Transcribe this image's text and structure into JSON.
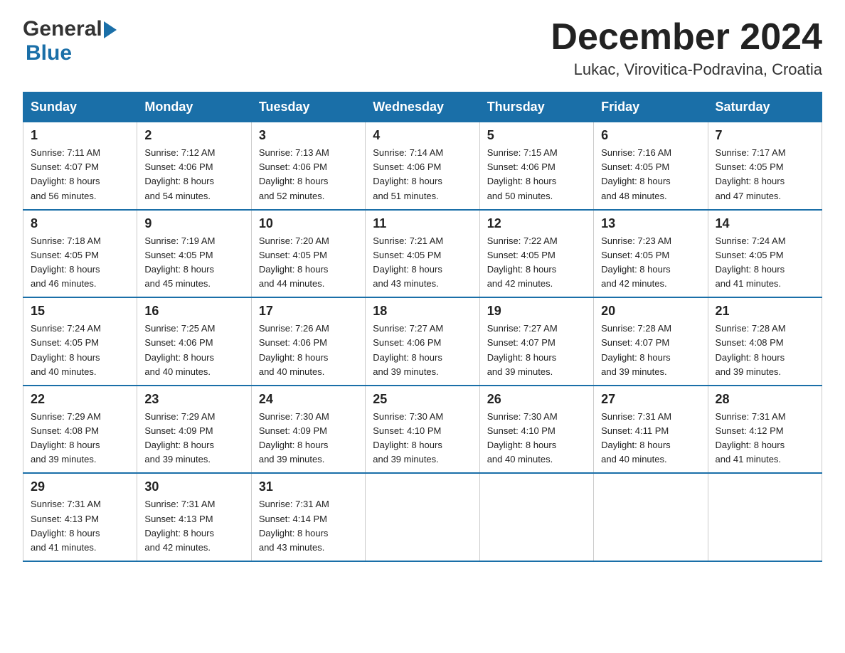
{
  "header": {
    "logo_general": "General",
    "logo_blue": "Blue",
    "title": "December 2024",
    "location": "Lukac, Virovitica-Podravina, Croatia"
  },
  "days_of_week": [
    "Sunday",
    "Monday",
    "Tuesday",
    "Wednesday",
    "Thursday",
    "Friday",
    "Saturday"
  ],
  "weeks": [
    [
      {
        "day": "1",
        "sunrise": "7:11 AM",
        "sunset": "4:07 PM",
        "daylight_hours": "8 hours",
        "daylight_minutes": "56 minutes"
      },
      {
        "day": "2",
        "sunrise": "7:12 AM",
        "sunset": "4:06 PM",
        "daylight_hours": "8 hours",
        "daylight_minutes": "54 minutes"
      },
      {
        "day": "3",
        "sunrise": "7:13 AM",
        "sunset": "4:06 PM",
        "daylight_hours": "8 hours",
        "daylight_minutes": "52 minutes"
      },
      {
        "day": "4",
        "sunrise": "7:14 AM",
        "sunset": "4:06 PM",
        "daylight_hours": "8 hours",
        "daylight_minutes": "51 minutes"
      },
      {
        "day": "5",
        "sunrise": "7:15 AM",
        "sunset": "4:06 PM",
        "daylight_hours": "8 hours",
        "daylight_minutes": "50 minutes"
      },
      {
        "day": "6",
        "sunrise": "7:16 AM",
        "sunset": "4:05 PM",
        "daylight_hours": "8 hours",
        "daylight_minutes": "48 minutes"
      },
      {
        "day": "7",
        "sunrise": "7:17 AM",
        "sunset": "4:05 PM",
        "daylight_hours": "8 hours",
        "daylight_minutes": "47 minutes"
      }
    ],
    [
      {
        "day": "8",
        "sunrise": "7:18 AM",
        "sunset": "4:05 PM",
        "daylight_hours": "8 hours",
        "daylight_minutes": "46 minutes"
      },
      {
        "day": "9",
        "sunrise": "7:19 AM",
        "sunset": "4:05 PM",
        "daylight_hours": "8 hours",
        "daylight_minutes": "45 minutes"
      },
      {
        "day": "10",
        "sunrise": "7:20 AM",
        "sunset": "4:05 PM",
        "daylight_hours": "8 hours",
        "daylight_minutes": "44 minutes"
      },
      {
        "day": "11",
        "sunrise": "7:21 AM",
        "sunset": "4:05 PM",
        "daylight_hours": "8 hours",
        "daylight_minutes": "43 minutes"
      },
      {
        "day": "12",
        "sunrise": "7:22 AM",
        "sunset": "4:05 PM",
        "daylight_hours": "8 hours",
        "daylight_minutes": "42 minutes"
      },
      {
        "day": "13",
        "sunrise": "7:23 AM",
        "sunset": "4:05 PM",
        "daylight_hours": "8 hours",
        "daylight_minutes": "42 minutes"
      },
      {
        "day": "14",
        "sunrise": "7:24 AM",
        "sunset": "4:05 PM",
        "daylight_hours": "8 hours",
        "daylight_minutes": "41 minutes"
      }
    ],
    [
      {
        "day": "15",
        "sunrise": "7:24 AM",
        "sunset": "4:05 PM",
        "daylight_hours": "8 hours",
        "daylight_minutes": "40 minutes"
      },
      {
        "day": "16",
        "sunrise": "7:25 AM",
        "sunset": "4:06 PM",
        "daylight_hours": "8 hours",
        "daylight_minutes": "40 minutes"
      },
      {
        "day": "17",
        "sunrise": "7:26 AM",
        "sunset": "4:06 PM",
        "daylight_hours": "8 hours",
        "daylight_minutes": "40 minutes"
      },
      {
        "day": "18",
        "sunrise": "7:27 AM",
        "sunset": "4:06 PM",
        "daylight_hours": "8 hours",
        "daylight_minutes": "39 minutes"
      },
      {
        "day": "19",
        "sunrise": "7:27 AM",
        "sunset": "4:07 PM",
        "daylight_hours": "8 hours",
        "daylight_minutes": "39 minutes"
      },
      {
        "day": "20",
        "sunrise": "7:28 AM",
        "sunset": "4:07 PM",
        "daylight_hours": "8 hours",
        "daylight_minutes": "39 minutes"
      },
      {
        "day": "21",
        "sunrise": "7:28 AM",
        "sunset": "4:08 PM",
        "daylight_hours": "8 hours",
        "daylight_minutes": "39 minutes"
      }
    ],
    [
      {
        "day": "22",
        "sunrise": "7:29 AM",
        "sunset": "4:08 PM",
        "daylight_hours": "8 hours",
        "daylight_minutes": "39 minutes"
      },
      {
        "day": "23",
        "sunrise": "7:29 AM",
        "sunset": "4:09 PM",
        "daylight_hours": "8 hours",
        "daylight_minutes": "39 minutes"
      },
      {
        "day": "24",
        "sunrise": "7:30 AM",
        "sunset": "4:09 PM",
        "daylight_hours": "8 hours",
        "daylight_minutes": "39 minutes"
      },
      {
        "day": "25",
        "sunrise": "7:30 AM",
        "sunset": "4:10 PM",
        "daylight_hours": "8 hours",
        "daylight_minutes": "39 minutes"
      },
      {
        "day": "26",
        "sunrise": "7:30 AM",
        "sunset": "4:10 PM",
        "daylight_hours": "8 hours",
        "daylight_minutes": "40 minutes"
      },
      {
        "day": "27",
        "sunrise": "7:31 AM",
        "sunset": "4:11 PM",
        "daylight_hours": "8 hours",
        "daylight_minutes": "40 minutes"
      },
      {
        "day": "28",
        "sunrise": "7:31 AM",
        "sunset": "4:12 PM",
        "daylight_hours": "8 hours",
        "daylight_minutes": "41 minutes"
      }
    ],
    [
      {
        "day": "29",
        "sunrise": "7:31 AM",
        "sunset": "4:13 PM",
        "daylight_hours": "8 hours",
        "daylight_minutes": "41 minutes"
      },
      {
        "day": "30",
        "sunrise": "7:31 AM",
        "sunset": "4:13 PM",
        "daylight_hours": "8 hours",
        "daylight_minutes": "42 minutes"
      },
      {
        "day": "31",
        "sunrise": "7:31 AM",
        "sunset": "4:14 PM",
        "daylight_hours": "8 hours",
        "daylight_minutes": "43 minutes"
      },
      null,
      null,
      null,
      null
    ]
  ],
  "labels": {
    "sunrise": "Sunrise:",
    "sunset": "Sunset:",
    "daylight": "Daylight:"
  }
}
